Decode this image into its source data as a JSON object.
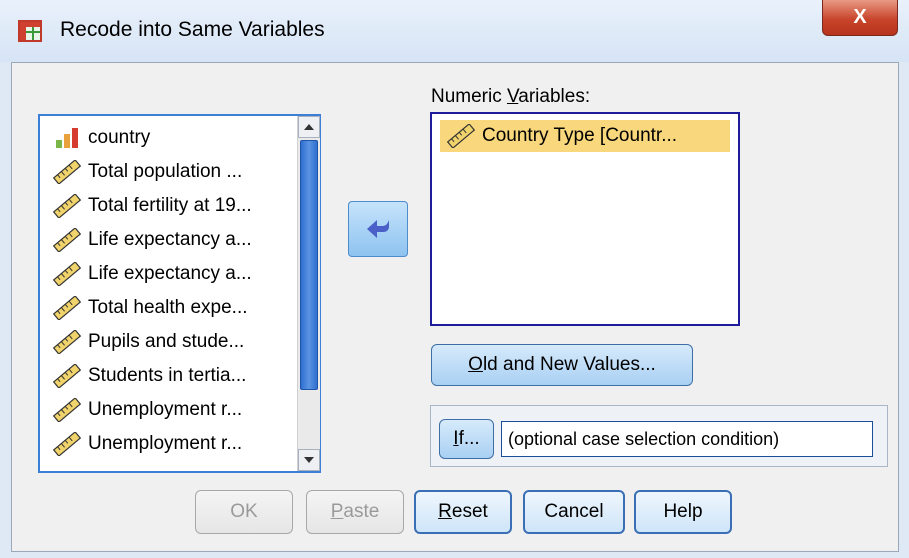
{
  "window": {
    "title": "Recode into Same Variables",
    "close_label": "X"
  },
  "source_variables": [
    {
      "label": "country",
      "icon": "nominal-bar-icon"
    },
    {
      "label": "Total population ...",
      "icon": "scale-ruler-icon"
    },
    {
      "label": "Total fertility at 19...",
      "icon": "scale-ruler-icon"
    },
    {
      "label": "Life expectancy a...",
      "icon": "scale-ruler-icon"
    },
    {
      "label": "Life expectancy a...",
      "icon": "scale-ruler-icon"
    },
    {
      "label": "Total health expe...",
      "icon": "scale-ruler-icon"
    },
    {
      "label": "Pupils and stude...",
      "icon": "scale-ruler-icon"
    },
    {
      "label": "Students in tertia...",
      "icon": "scale-ruler-icon"
    },
    {
      "label": "Unemployment r...",
      "icon": "scale-ruler-icon"
    },
    {
      "label": "Unemployment r...",
      "icon": "scale-ruler-icon"
    }
  ],
  "numeric_variables": {
    "label_prefix": "Numeric ",
    "label_mnemonic": "V",
    "label_suffix": "ariables:",
    "items": [
      {
        "label": "Country Type [Countr...",
        "icon": "scale-ruler-icon"
      }
    ]
  },
  "buttons": {
    "old_new_mnemonic": "O",
    "old_new_rest": "ld and New Values...",
    "if_mnemonic": "I",
    "if_rest": "f...",
    "if_condition_text": "(optional case selection condition)",
    "ok": "OK",
    "paste_mnemonic": "P",
    "paste_rest": "aste",
    "reset_mnemonic": "R",
    "reset_rest": "eset",
    "cancel": "Cancel",
    "help": "Help"
  },
  "colors": {
    "selection": "#f9d77c",
    "focus_border": "#1d1d9c",
    "arrow": "#4a5fc8"
  }
}
